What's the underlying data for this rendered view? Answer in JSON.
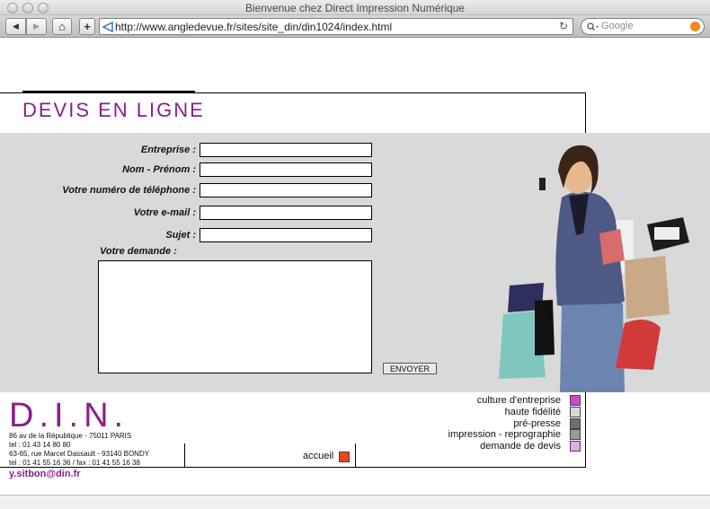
{
  "browser": {
    "window_title": "Bienvenue chez Direct Impression Numérique",
    "url": "http://www.angledevue.fr/sites/site_din/din1024/index.html",
    "search_placeholder": "Google",
    "back_icon": "◀",
    "forward_icon": "▶",
    "home_icon": "⌂",
    "add_icon": "+",
    "reload_icon": "↻"
  },
  "page": {
    "title": "DEVIS EN LIGNE",
    "accent_color": "#8a1f8c"
  },
  "form": {
    "fields": [
      {
        "label": "Entreprise :",
        "value": ""
      },
      {
        "label": "Nom - Prénom :",
        "value": ""
      },
      {
        "label": "Votre numéro de téléphone :",
        "value": ""
      },
      {
        "label": "Votre e-mail :",
        "value": ""
      },
      {
        "label": "Sujet :",
        "value": ""
      }
    ],
    "demande_label": "Votre demande :",
    "demande_value": "",
    "submit_label": "ENVOYER"
  },
  "footer": {
    "logo": "D.I.N.",
    "address_lines": [
      "86 av de la République - 75011 PARIS",
      "tel : 01 43 14 80 80",
      "63-65, rue Marcel Dassault - 93140 BONDY",
      "tel : 01 41 55 16 36 / fax : 01 41 55 16 38"
    ],
    "email": "y.sitbon@din.fr",
    "accueil": "accueil",
    "menu": [
      {
        "label": "culture d'entreprise",
        "color": "#c84bc8"
      },
      {
        "label": "haute fidélité",
        "color": "#d8d8d8"
      },
      {
        "label": "pré-presse",
        "color": "#6f6f6f"
      },
      {
        "label": "impression - reprographie",
        "color": "#9a9a9a"
      },
      {
        "label": "demande de devis",
        "color": "#e6a8e6"
      }
    ]
  }
}
